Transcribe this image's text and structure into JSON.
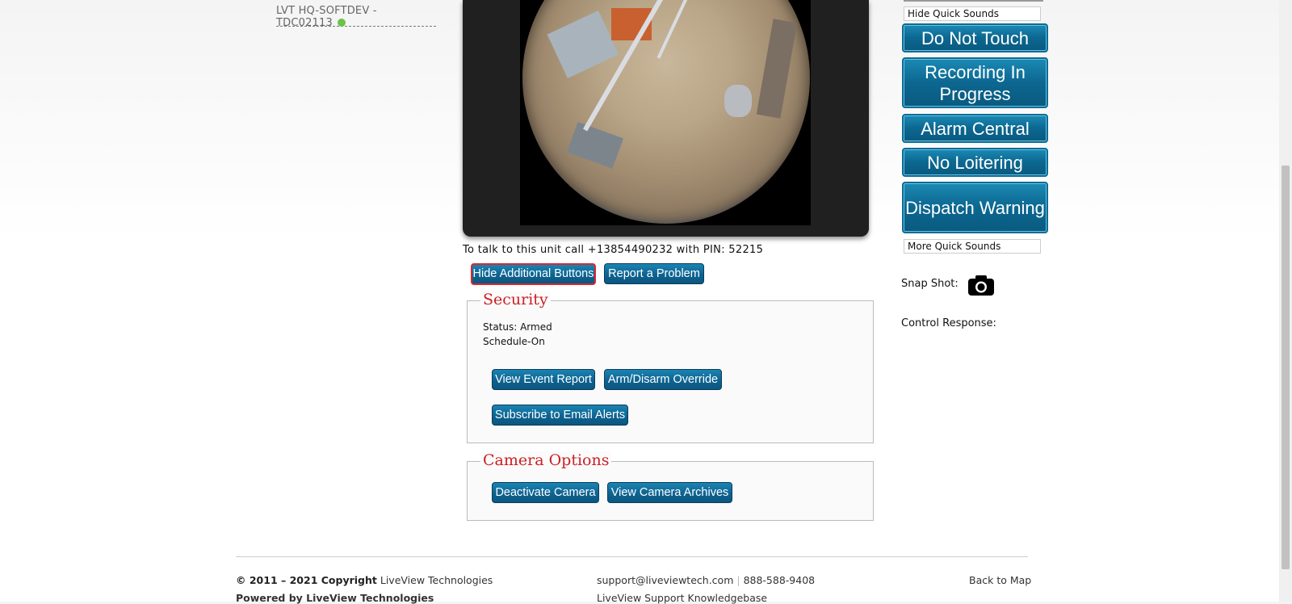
{
  "camera_list": {
    "items": [
      {
        "label": "LVT HQ-SOFTDEV - TDC02113",
        "status_color": "#6cc24a"
      }
    ]
  },
  "video": {
    "talk_note": "To talk to this unit call +13854490232 with PIN: 52215"
  },
  "actions": {
    "hide_additional": "Hide Additional Buttons",
    "report_problem": "Report a Problem"
  },
  "security": {
    "legend": "Security",
    "status": "Status: Armed",
    "schedule": "Schedule-On",
    "view_event_report": "View Event Report",
    "arm_disarm": "Arm/Disarm Override",
    "subscribe": "Subscribe to Email Alerts"
  },
  "camera_options": {
    "legend": "Camera Options",
    "deactivate": "Deactivate Camera",
    "archives": "View Camera Archives"
  },
  "quick_sounds": {
    "hide_label": "Hide Quick Sounds",
    "more_label": "More Quick Sounds",
    "buttons": [
      "Do Not Touch",
      "Recording In Progress",
      "Alarm Central",
      "No Loitering",
      "Dispatch Warning"
    ]
  },
  "snapshot": {
    "label": "Snap Shot:",
    "icon": "camera-icon"
  },
  "control_response": {
    "label": "Control Response:"
  },
  "footer": {
    "copyright_bold": "© 2011 – 2021 Copyright",
    "copyright_company": "LiveView Technologies",
    "powered_by": "Powered by LiveView Technologies",
    "email": "support@liveviewtech.com",
    "separator": "|",
    "phone": "888-588-9408",
    "knowledgebase": "LiveView Support Knowledgebase",
    "back_to_map": "Back to Map"
  },
  "colors": {
    "accent_blue": "#0e6390",
    "legend_red": "#cc1f26",
    "status_green": "#6cc24a"
  }
}
